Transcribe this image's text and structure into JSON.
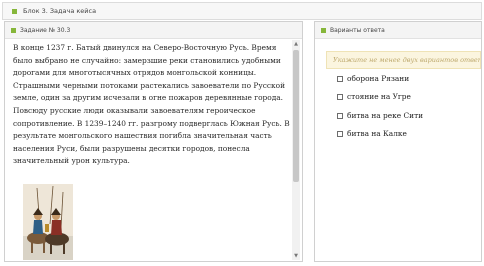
{
  "block": {
    "title": "Блок 3. Задача кейса"
  },
  "task": {
    "header": "Задание № 30.3",
    "paragraph": "В конце 1237 г. Батый двинулся на Северо-Восточную Русь. Время было выбрано не случайно: замерзшие реки становились удобными дорогами для многотысячных отрядов монгольской конницы. Страшными черными потоками растекались завоеватели по Русской земле, один за другим исчезали в огне пожаров деревянные города. Повсюду русские люди оказывали завоевателям героическое сопротивление. В 1239–1240 гг. разгрому подверглась Южная Русь. В результате монгольского нашествия погибла значительная часть населения Руси, были разрушены десятки городов, понесла значительный урон культура.",
    "illustration_text": "Монгольские всадники"
  },
  "answers": {
    "header": "Варианты ответа",
    "hint": "Укажите не менее двух вариантов ответа",
    "options": [
      {
        "label": "оборона Рязани"
      },
      {
        "label": "стояние на Угре"
      },
      {
        "label": "битва на реке Сити"
      },
      {
        "label": "битва на Калке"
      }
    ]
  },
  "colors": {
    "accent": "#86b63a",
    "hint_bg": "#fbf5df",
    "hint_text": "#bda86d"
  }
}
